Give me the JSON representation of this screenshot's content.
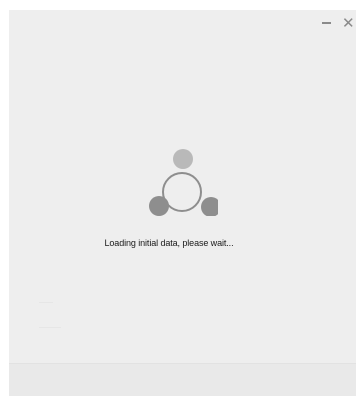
{
  "window": {
    "minimize_label": "minimize",
    "close_glyph": "✕"
  },
  "loading": {
    "message": "Loading initial data, please wait..."
  },
  "spinner": {
    "colors": {
      "top_dot": "#b9b9b9",
      "left_dot": "#8e8e8e",
      "right_dot": "#8e8e8e",
      "ring": "#8e8e8e"
    }
  }
}
